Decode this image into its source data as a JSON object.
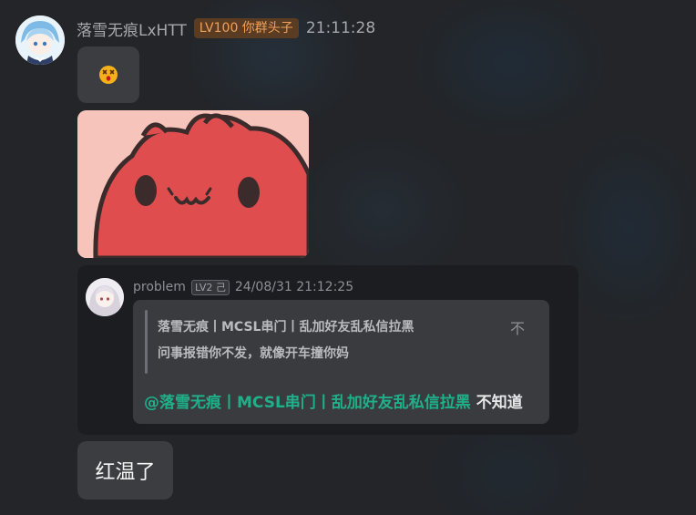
{
  "message": {
    "sender_name": "落雪无痕LxHTT",
    "level_badge": "LV100 你群头子",
    "time": "21:11:28",
    "emoji_icon": "dizzy-face-emoji",
    "sticker_icon": "red-cat-sticker"
  },
  "quote": {
    "author": "problem",
    "level": "LV2 己",
    "time": "24/08/31 21:12:25",
    "quoted_author": "落雪无痕丨MCSL串门丨乱加好友乱私信拉黑",
    "quoted_text": "问事报错你不发，就像开车撞你妈",
    "close_label": "不",
    "reply_mention": "@落雪无痕丨MCSL串门丨乱加好友乱私信拉黑",
    "reply_text": " 不知道"
  },
  "bubble_text": "红温了",
  "colors": {
    "background": "#232528",
    "bubble": "#3b3d40",
    "level_badge_bg": "#5a3c23",
    "level_badge_text": "#f0a15a",
    "mention": "#1fb08a"
  }
}
